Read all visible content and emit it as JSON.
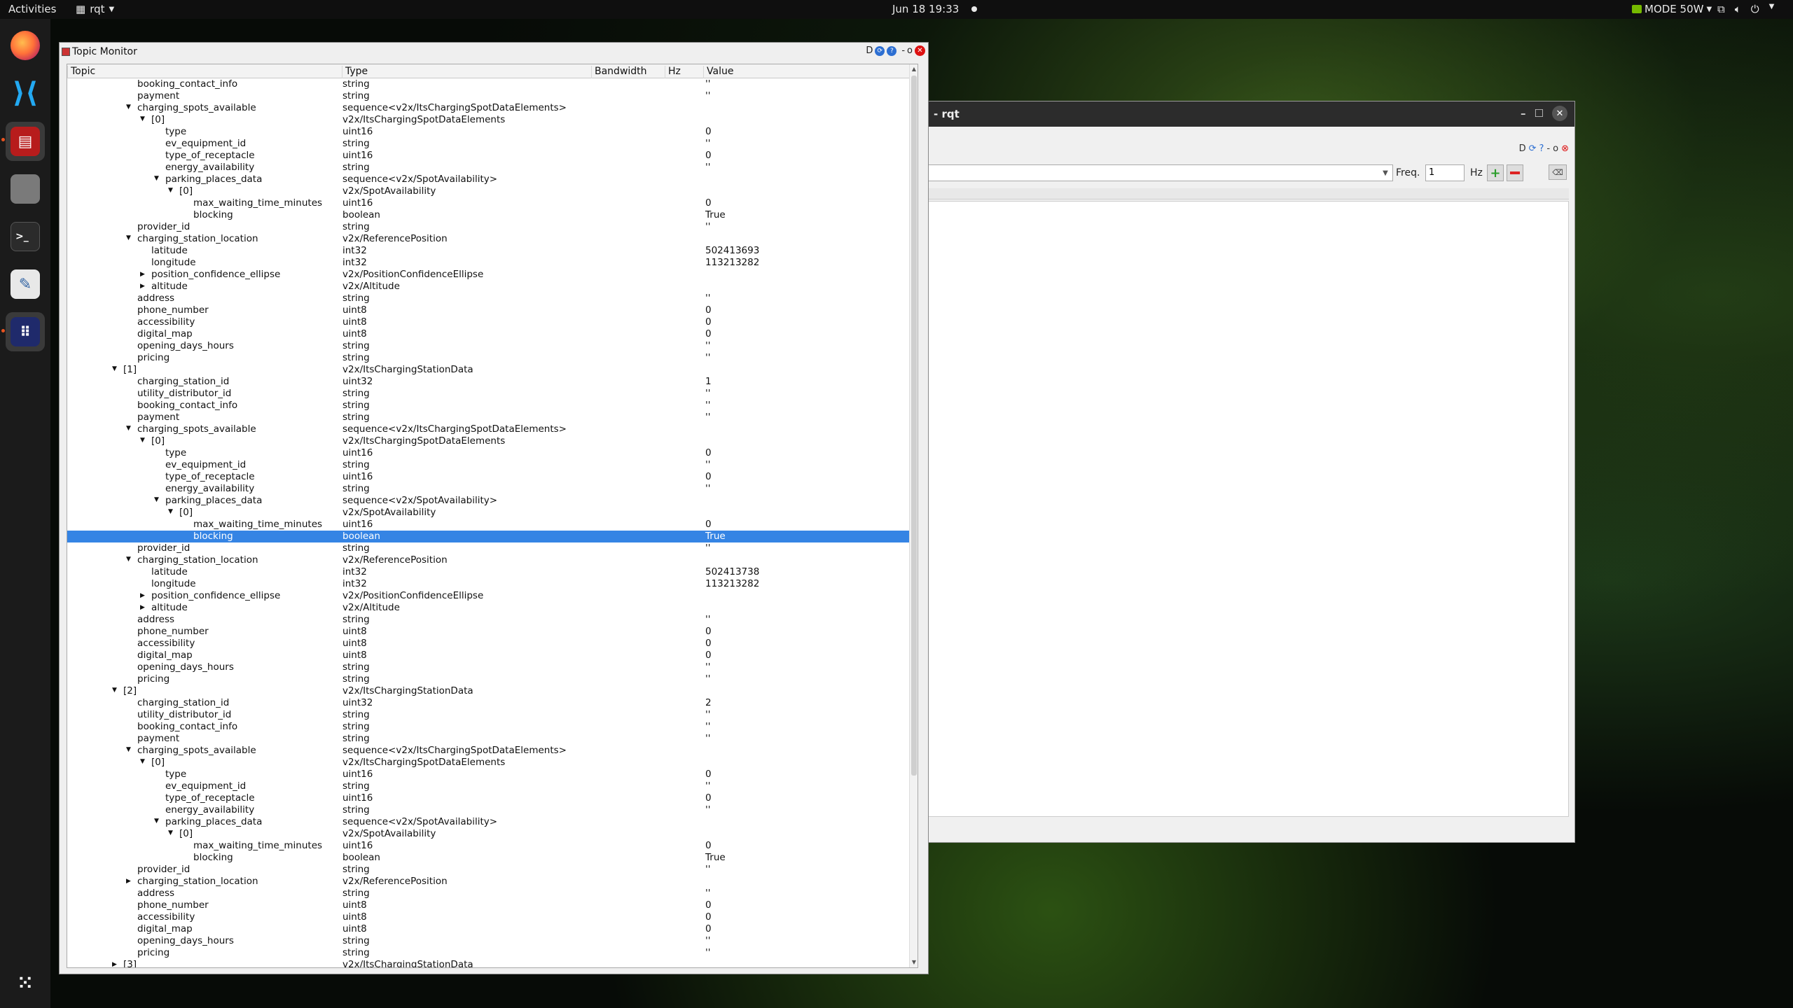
{
  "topbar": {
    "activities": "Activities",
    "app_name": "rqt",
    "clock": "Jun 18  19:33",
    "power_mode": "MODE 50W"
  },
  "rqt_window": {
    "title": "- rqt",
    "freq_label": "Freq.",
    "freq_value": "1",
    "hz_label": "Hz"
  },
  "topic_monitor": {
    "title": "Topic Monitor",
    "columns": [
      "Topic",
      "Type",
      "Bandwidth",
      "Hz",
      "Value"
    ],
    "rows": [
      {
        "d": 6,
        "a": "",
        "t": "booking_contact_info",
        "ty": "string",
        "v": "''"
      },
      {
        "d": 6,
        "a": "",
        "t": "payment",
        "ty": "string",
        "v": "''"
      },
      {
        "d": 6,
        "a": "open",
        "t": "charging_spots_available",
        "ty": "sequence<v2x/ItsChargingSpotDataElements>",
        "v": ""
      },
      {
        "d": 7,
        "a": "open",
        "t": "[0]",
        "ty": "v2x/ItsChargingSpotDataElements",
        "v": ""
      },
      {
        "d": 8,
        "a": "",
        "t": "type",
        "ty": "uint16",
        "v": "0"
      },
      {
        "d": 8,
        "a": "",
        "t": "ev_equipment_id",
        "ty": "string",
        "v": "''"
      },
      {
        "d": 8,
        "a": "",
        "t": "type_of_receptacle",
        "ty": "uint16",
        "v": "0"
      },
      {
        "d": 8,
        "a": "",
        "t": "energy_availability",
        "ty": "string",
        "v": "''"
      },
      {
        "d": 8,
        "a": "open",
        "t": "parking_places_data",
        "ty": "sequence<v2x/SpotAvailability>",
        "v": ""
      },
      {
        "d": 9,
        "a": "open",
        "t": "[0]",
        "ty": "v2x/SpotAvailability",
        "v": ""
      },
      {
        "d": 10,
        "a": "",
        "t": "max_waiting_time_minutes",
        "ty": "uint16",
        "v": "0"
      },
      {
        "d": 10,
        "a": "",
        "t": "blocking",
        "ty": "boolean",
        "v": "True"
      },
      {
        "d": 6,
        "a": "",
        "t": "provider_id",
        "ty": "string",
        "v": "''"
      },
      {
        "d": 6,
        "a": "open",
        "t": "charging_station_location",
        "ty": "v2x/ReferencePosition",
        "v": ""
      },
      {
        "d": 7,
        "a": "",
        "t": "latitude",
        "ty": "int32",
        "v": "502413693"
      },
      {
        "d": 7,
        "a": "",
        "t": "longitude",
        "ty": "int32",
        "v": "113213282"
      },
      {
        "d": 7,
        "a": "closed",
        "t": "position_confidence_ellipse",
        "ty": "v2x/PositionConfidenceEllipse",
        "v": ""
      },
      {
        "d": 7,
        "a": "closed",
        "t": "altitude",
        "ty": "v2x/Altitude",
        "v": ""
      },
      {
        "d": 6,
        "a": "",
        "t": "address",
        "ty": "string",
        "v": "''"
      },
      {
        "d": 6,
        "a": "",
        "t": "phone_number",
        "ty": "uint8",
        "v": "0"
      },
      {
        "d": 6,
        "a": "",
        "t": "accessibility",
        "ty": "uint8",
        "v": "0"
      },
      {
        "d": 6,
        "a": "",
        "t": "digital_map",
        "ty": "uint8",
        "v": "0"
      },
      {
        "d": 6,
        "a": "",
        "t": "opening_days_hours",
        "ty": "string",
        "v": "''"
      },
      {
        "d": 6,
        "a": "",
        "t": "pricing",
        "ty": "string",
        "v": "''"
      },
      {
        "d": 5,
        "a": "open",
        "t": "[1]",
        "ty": "v2x/ItsChargingStationData",
        "v": ""
      },
      {
        "d": 6,
        "a": "",
        "t": "charging_station_id",
        "ty": "uint32",
        "v": "1"
      },
      {
        "d": 6,
        "a": "",
        "t": "utility_distributor_id",
        "ty": "string",
        "v": "''"
      },
      {
        "d": 6,
        "a": "",
        "t": "booking_contact_info",
        "ty": "string",
        "v": "''"
      },
      {
        "d": 6,
        "a": "",
        "t": "payment",
        "ty": "string",
        "v": "''"
      },
      {
        "d": 6,
        "a": "open",
        "t": "charging_spots_available",
        "ty": "sequence<v2x/ItsChargingSpotDataElements>",
        "v": ""
      },
      {
        "d": 7,
        "a": "open",
        "t": "[0]",
        "ty": "v2x/ItsChargingSpotDataElements",
        "v": ""
      },
      {
        "d": 8,
        "a": "",
        "t": "type",
        "ty": "uint16",
        "v": "0"
      },
      {
        "d": 8,
        "a": "",
        "t": "ev_equipment_id",
        "ty": "string",
        "v": "''"
      },
      {
        "d": 8,
        "a": "",
        "t": "type_of_receptacle",
        "ty": "uint16",
        "v": "0"
      },
      {
        "d": 8,
        "a": "",
        "t": "energy_availability",
        "ty": "string",
        "v": "''"
      },
      {
        "d": 8,
        "a": "open",
        "t": "parking_places_data",
        "ty": "sequence<v2x/SpotAvailability>",
        "v": ""
      },
      {
        "d": 9,
        "a": "open",
        "t": "[0]",
        "ty": "v2x/SpotAvailability",
        "v": ""
      },
      {
        "d": 10,
        "a": "",
        "t": "max_waiting_time_minutes",
        "ty": "uint16",
        "v": "0"
      },
      {
        "d": 10,
        "a": "",
        "t": "blocking",
        "ty": "boolean",
        "v": "True",
        "selected": true
      },
      {
        "d": 6,
        "a": "",
        "t": "provider_id",
        "ty": "string",
        "v": "''"
      },
      {
        "d": 6,
        "a": "open",
        "t": "charging_station_location",
        "ty": "v2x/ReferencePosition",
        "v": ""
      },
      {
        "d": 7,
        "a": "",
        "t": "latitude",
        "ty": "int32",
        "v": "502413738"
      },
      {
        "d": 7,
        "a": "",
        "t": "longitude",
        "ty": "int32",
        "v": "113213282"
      },
      {
        "d": 7,
        "a": "closed",
        "t": "position_confidence_ellipse",
        "ty": "v2x/PositionConfidenceEllipse",
        "v": ""
      },
      {
        "d": 7,
        "a": "closed",
        "t": "altitude",
        "ty": "v2x/Altitude",
        "v": ""
      },
      {
        "d": 6,
        "a": "",
        "t": "address",
        "ty": "string",
        "v": "''"
      },
      {
        "d": 6,
        "a": "",
        "t": "phone_number",
        "ty": "uint8",
        "v": "0"
      },
      {
        "d": 6,
        "a": "",
        "t": "accessibility",
        "ty": "uint8",
        "v": "0"
      },
      {
        "d": 6,
        "a": "",
        "t": "digital_map",
        "ty": "uint8",
        "v": "0"
      },
      {
        "d": 6,
        "a": "",
        "t": "opening_days_hours",
        "ty": "string",
        "v": "''"
      },
      {
        "d": 6,
        "a": "",
        "t": "pricing",
        "ty": "string",
        "v": "''"
      },
      {
        "d": 5,
        "a": "open",
        "t": "[2]",
        "ty": "v2x/ItsChargingStationData",
        "v": ""
      },
      {
        "d": 6,
        "a": "",
        "t": "charging_station_id",
        "ty": "uint32",
        "v": "2"
      },
      {
        "d": 6,
        "a": "",
        "t": "utility_distributor_id",
        "ty": "string",
        "v": "''"
      },
      {
        "d": 6,
        "a": "",
        "t": "booking_contact_info",
        "ty": "string",
        "v": "''"
      },
      {
        "d": 6,
        "a": "",
        "t": "payment",
        "ty": "string",
        "v": "''"
      },
      {
        "d": 6,
        "a": "open",
        "t": "charging_spots_available",
        "ty": "sequence<v2x/ItsChargingSpotDataElements>",
        "v": ""
      },
      {
        "d": 7,
        "a": "open",
        "t": "[0]",
        "ty": "v2x/ItsChargingSpotDataElements",
        "v": ""
      },
      {
        "d": 8,
        "a": "",
        "t": "type",
        "ty": "uint16",
        "v": "0"
      },
      {
        "d": 8,
        "a": "",
        "t": "ev_equipment_id",
        "ty": "string",
        "v": "''"
      },
      {
        "d": 8,
        "a": "",
        "t": "type_of_receptacle",
        "ty": "uint16",
        "v": "0"
      },
      {
        "d": 8,
        "a": "",
        "t": "energy_availability",
        "ty": "string",
        "v": "''"
      },
      {
        "d": 8,
        "a": "open",
        "t": "parking_places_data",
        "ty": "sequence<v2x/SpotAvailability>",
        "v": ""
      },
      {
        "d": 9,
        "a": "open",
        "t": "[0]",
        "ty": "v2x/SpotAvailability",
        "v": ""
      },
      {
        "d": 10,
        "a": "",
        "t": "max_waiting_time_minutes",
        "ty": "uint16",
        "v": "0"
      },
      {
        "d": 10,
        "a": "",
        "t": "blocking",
        "ty": "boolean",
        "v": "True"
      },
      {
        "d": 6,
        "a": "",
        "t": "provider_id",
        "ty": "string",
        "v": "''"
      },
      {
        "d": 6,
        "a": "closed",
        "t": "charging_station_location",
        "ty": "v2x/ReferencePosition",
        "v": ""
      },
      {
        "d": 6,
        "a": "",
        "t": "address",
        "ty": "string",
        "v": "''"
      },
      {
        "d": 6,
        "a": "",
        "t": "phone_number",
        "ty": "uint8",
        "v": "0"
      },
      {
        "d": 6,
        "a": "",
        "t": "accessibility",
        "ty": "uint8",
        "v": "0"
      },
      {
        "d": 6,
        "a": "",
        "t": "digital_map",
        "ty": "uint8",
        "v": "0"
      },
      {
        "d": 6,
        "a": "",
        "t": "opening_days_hours",
        "ty": "string",
        "v": "''"
      },
      {
        "d": 6,
        "a": "",
        "t": "pricing",
        "ty": "string",
        "v": "''"
      },
      {
        "d": 5,
        "a": "closed",
        "t": "[3]",
        "ty": "v2x/ItsChargingStationData",
        "v": ""
      }
    ]
  }
}
